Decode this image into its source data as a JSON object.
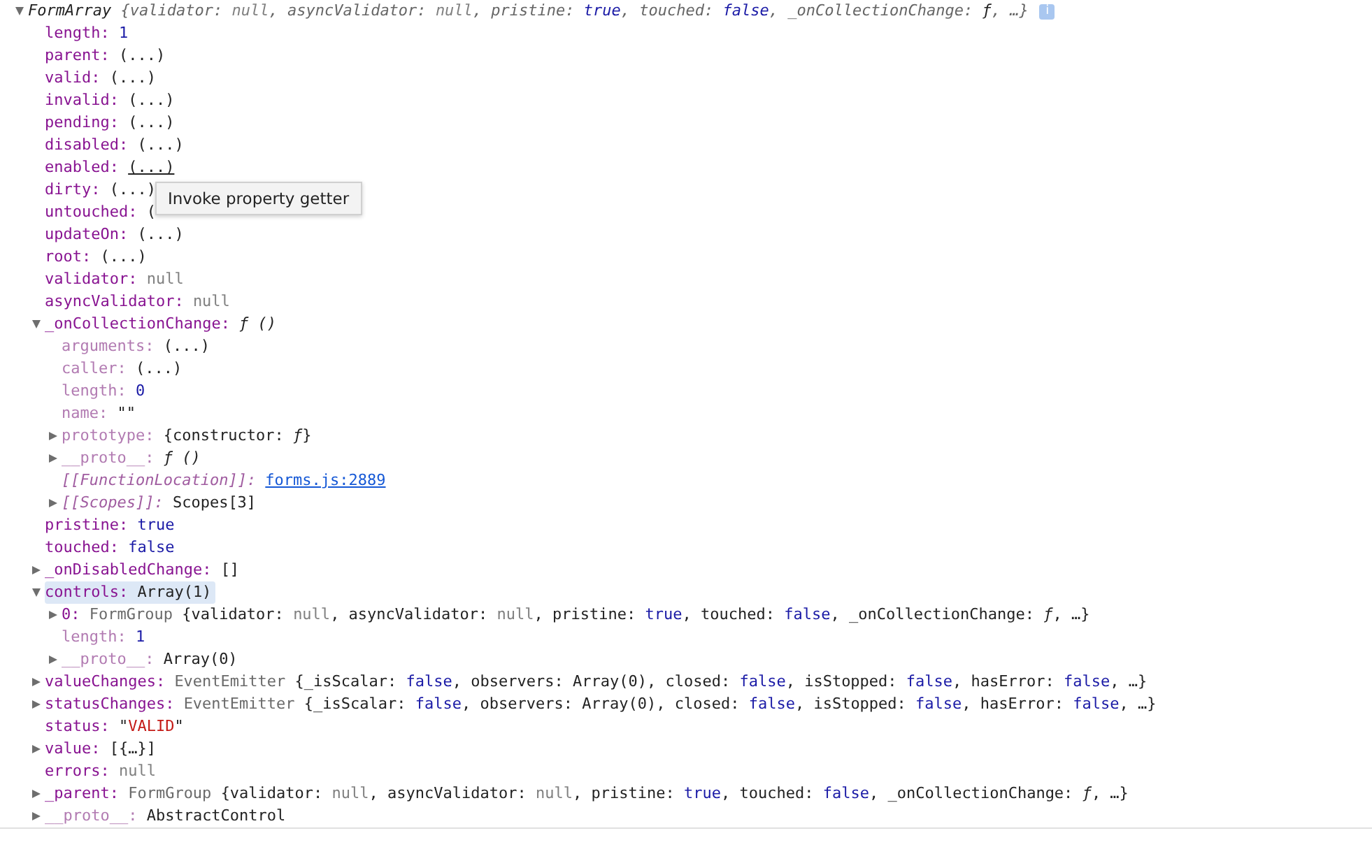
{
  "object": {
    "expanded": true,
    "info_badge": "i",
    "segments": [
      {
        "text": "FormArray ",
        "kind": "plain"
      },
      {
        "text": "{validator: ",
        "kind": "pkey"
      },
      {
        "text": "null",
        "kind": "null"
      },
      {
        "text": ", asyncValidator: ",
        "kind": "pkey"
      },
      {
        "text": "null",
        "kind": "null"
      },
      {
        "text": ", pristine: ",
        "kind": "pkey"
      },
      {
        "text": "true",
        "kind": "lit"
      },
      {
        "text": ", touched: ",
        "kind": "pkey"
      },
      {
        "text": "false",
        "kind": "lit"
      },
      {
        "text": ", _onCollectionChange: ",
        "kind": "pkey"
      },
      {
        "text": "ƒ",
        "kind": "plain"
      },
      {
        "text": ", …}",
        "kind": "pkey"
      }
    ],
    "children": [
      {
        "key": "length:",
        "kind": "own",
        "value": [
          {
            "text": "1",
            "kind": "lit"
          }
        ]
      },
      {
        "key": "parent:",
        "kind": "own",
        "value": [
          {
            "text": "(...)",
            "kind": "getter"
          }
        ]
      },
      {
        "key": "valid:",
        "kind": "own",
        "value": [
          {
            "text": "(...)",
            "kind": "getter"
          }
        ]
      },
      {
        "key": "invalid:",
        "kind": "own",
        "value": [
          {
            "text": "(...)",
            "kind": "getter"
          }
        ]
      },
      {
        "key": "pending:",
        "kind": "own",
        "value": [
          {
            "text": "(...)",
            "kind": "getter"
          }
        ]
      },
      {
        "key": "disabled:",
        "kind": "own",
        "value": [
          {
            "text": "(...)",
            "kind": "getter"
          }
        ]
      },
      {
        "key": "enabled:",
        "kind": "own",
        "value": [
          {
            "text": "(...)",
            "kind": "getter",
            "hover": true
          }
        ]
      },
      {
        "key": "dirty:",
        "kind": "own",
        "value": [
          {
            "text": "(...)",
            "kind": "getter"
          }
        ]
      },
      {
        "key": "untouched:",
        "kind": "own",
        "value": [
          {
            "text": "(",
            "kind": "getter"
          }
        ]
      },
      {
        "key": "updateOn:",
        "kind": "own",
        "value": [
          {
            "text": "(...)",
            "kind": "getter"
          }
        ]
      },
      {
        "key": "root:",
        "kind": "own",
        "value": [
          {
            "text": "(...)",
            "kind": "getter"
          }
        ]
      },
      {
        "key": "validator:",
        "kind": "own",
        "value": [
          {
            "text": "null",
            "kind": "null"
          }
        ]
      },
      {
        "key": "asyncValidator:",
        "kind": "own",
        "value": [
          {
            "text": "null",
            "kind": "null"
          }
        ]
      },
      {
        "key": "_onCollectionChange:",
        "kind": "own",
        "expanded": true,
        "value": [
          {
            "text": "ƒ ()",
            "kind": "func"
          }
        ],
        "children": [
          {
            "key": "arguments:",
            "kind": "dim",
            "value": [
              {
                "text": "(...)",
                "kind": "getter"
              }
            ]
          },
          {
            "key": "caller:",
            "kind": "dim",
            "value": [
              {
                "text": "(...)",
                "kind": "getter"
              }
            ]
          },
          {
            "key": "length:",
            "kind": "dim",
            "value": [
              {
                "text": "0",
                "kind": "lit"
              }
            ]
          },
          {
            "key": "name:",
            "kind": "dim",
            "value": [
              {
                "text": "\"\"",
                "kind": "plain"
              }
            ]
          },
          {
            "key": "prototype:",
            "kind": "dim",
            "expanded": false,
            "value": [
              {
                "text": "{constructor: ",
                "kind": "plain"
              },
              {
                "text": "ƒ",
                "kind": "func"
              },
              {
                "text": "}",
                "kind": "plain"
              }
            ]
          },
          {
            "key": "__proto__:",
            "kind": "dim",
            "expanded": false,
            "value": [
              {
                "text": "ƒ ()",
                "kind": "func"
              }
            ]
          },
          {
            "key": "[[FunctionLocation]]:",
            "kind": "internal",
            "value": [
              {
                "text": "forms.js:2889",
                "kind": "link"
              }
            ]
          },
          {
            "key": "[[Scopes]]:",
            "kind": "internal",
            "expanded": false,
            "value": [
              {
                "text": "Scopes[3]",
                "kind": "plain"
              }
            ]
          }
        ]
      },
      {
        "key": "pristine:",
        "kind": "own",
        "value": [
          {
            "text": "true",
            "kind": "lit"
          }
        ]
      },
      {
        "key": "touched:",
        "kind": "own",
        "value": [
          {
            "text": "false",
            "kind": "lit"
          }
        ]
      },
      {
        "key": "_onDisabledChange:",
        "kind": "own",
        "expanded": false,
        "value": [
          {
            "text": "[]",
            "kind": "plain"
          }
        ]
      },
      {
        "key": "controls:",
        "kind": "own",
        "expanded": true,
        "highlighted": true,
        "value": [
          {
            "text": "Array(1)",
            "kind": "plain"
          }
        ],
        "children": [
          {
            "key": "0:",
            "kind": "own",
            "expanded": false,
            "value": [
              {
                "text": "FormGroup ",
                "kind": "type"
              },
              {
                "text": "{validator: ",
                "kind": "plain"
              },
              {
                "text": "null",
                "kind": "null"
              },
              {
                "text": ", asyncValidator: ",
                "kind": "plain"
              },
              {
                "text": "null",
                "kind": "null"
              },
              {
                "text": ", pristine: ",
                "kind": "plain"
              },
              {
                "text": "true",
                "kind": "lit"
              },
              {
                "text": ", touched: ",
                "kind": "plain"
              },
              {
                "text": "false",
                "kind": "lit"
              },
              {
                "text": ", _onCollectionChange: ",
                "kind": "plain"
              },
              {
                "text": "ƒ",
                "kind": "func"
              },
              {
                "text": ", …}",
                "kind": "plain"
              }
            ]
          },
          {
            "key": "length:",
            "kind": "dim",
            "value": [
              {
                "text": "1",
                "kind": "lit"
              }
            ]
          },
          {
            "key": "__proto__:",
            "kind": "dim",
            "expanded": false,
            "value": [
              {
                "text": "Array(0)",
                "kind": "plain"
              }
            ]
          }
        ]
      },
      {
        "key": "valueChanges:",
        "kind": "own",
        "expanded": false,
        "value": [
          {
            "text": "EventEmitter ",
            "kind": "type"
          },
          {
            "text": "{_isScalar: ",
            "kind": "plain"
          },
          {
            "text": "false",
            "kind": "lit"
          },
          {
            "text": ", observers: Array(0), closed: ",
            "kind": "plain"
          },
          {
            "text": "false",
            "kind": "lit"
          },
          {
            "text": ", isStopped: ",
            "kind": "plain"
          },
          {
            "text": "false",
            "kind": "lit"
          },
          {
            "text": ", hasError: ",
            "kind": "plain"
          },
          {
            "text": "false",
            "kind": "lit"
          },
          {
            "text": ", …}",
            "kind": "plain"
          }
        ]
      },
      {
        "key": "statusChanges:",
        "kind": "own",
        "expanded": false,
        "value": [
          {
            "text": "EventEmitter ",
            "kind": "type"
          },
          {
            "text": "{_isScalar: ",
            "kind": "plain"
          },
          {
            "text": "false",
            "kind": "lit"
          },
          {
            "text": ", observers: Array(0), closed: ",
            "kind": "plain"
          },
          {
            "text": "false",
            "kind": "lit"
          },
          {
            "text": ", isStopped: ",
            "kind": "plain"
          },
          {
            "text": "false",
            "kind": "lit"
          },
          {
            "text": ", hasError: ",
            "kind": "plain"
          },
          {
            "text": "false",
            "kind": "lit"
          },
          {
            "text": ", …}",
            "kind": "plain"
          }
        ]
      },
      {
        "key": "status:",
        "kind": "own",
        "value": [
          {
            "text": "\"",
            "kind": "plain"
          },
          {
            "text": "VALID",
            "kind": "str"
          },
          {
            "text": "\"",
            "kind": "plain"
          }
        ]
      },
      {
        "key": "value:",
        "kind": "own",
        "expanded": false,
        "value": [
          {
            "text": "[{…}]",
            "kind": "plain"
          }
        ]
      },
      {
        "key": "errors:",
        "kind": "own",
        "value": [
          {
            "text": "null",
            "kind": "null"
          }
        ]
      },
      {
        "key": "_parent:",
        "kind": "own",
        "expanded": false,
        "value": [
          {
            "text": "FormGroup ",
            "kind": "type"
          },
          {
            "text": "{validator: ",
            "kind": "plain"
          },
          {
            "text": "null",
            "kind": "null"
          },
          {
            "text": ", asyncValidator: ",
            "kind": "plain"
          },
          {
            "text": "null",
            "kind": "null"
          },
          {
            "text": ", pristine: ",
            "kind": "plain"
          },
          {
            "text": "true",
            "kind": "lit"
          },
          {
            "text": ", touched: ",
            "kind": "plain"
          },
          {
            "text": "false",
            "kind": "lit"
          },
          {
            "text": ", _onCollectionChange: ",
            "kind": "plain"
          },
          {
            "text": "ƒ",
            "kind": "func"
          },
          {
            "text": ", …}",
            "kind": "plain"
          }
        ]
      },
      {
        "key": "__proto__:",
        "kind": "dim",
        "expanded": false,
        "value": [
          {
            "text": "AbstractControl",
            "kind": "plain"
          }
        ]
      }
    ]
  },
  "tooltip": {
    "text": "Invoke property getter"
  }
}
